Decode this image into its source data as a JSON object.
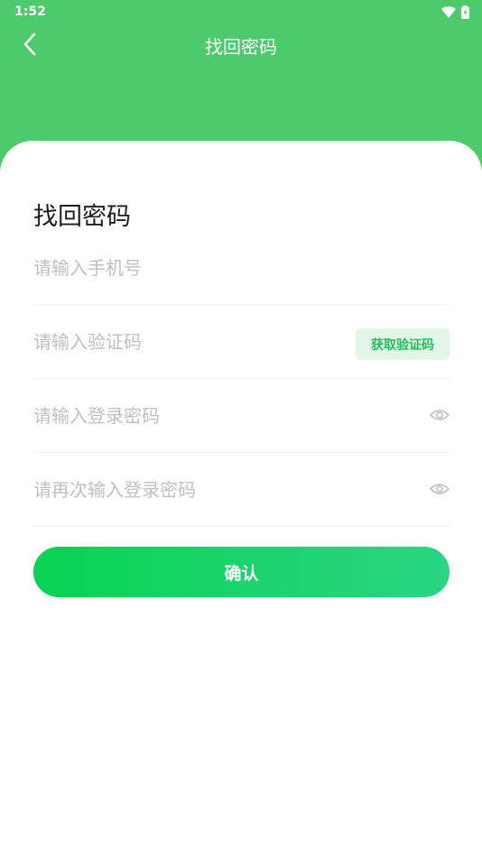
{
  "status_bar": {
    "time": "1:52"
  },
  "nav": {
    "title": "找回密码"
  },
  "form": {
    "title": "找回密码",
    "phone_placeholder": "请输入手机号",
    "code_placeholder": "请输入验证码",
    "get_code_label": "获取验证码",
    "password_placeholder": "请输入登录密码",
    "confirm_password_placeholder": "请再次输入登录密码",
    "submit_label": "确认"
  },
  "icons": {
    "back": "chevron-left-icon",
    "wifi": "wifi-icon",
    "battery": "battery-icon",
    "eye": "eye-icon"
  },
  "colors": {
    "header": "#4cca6c",
    "accent": "#1fc15a",
    "button_gradient_start": "#07d353",
    "button_gradient_end": "#2bd584",
    "placeholder": "#c0c0c0"
  }
}
